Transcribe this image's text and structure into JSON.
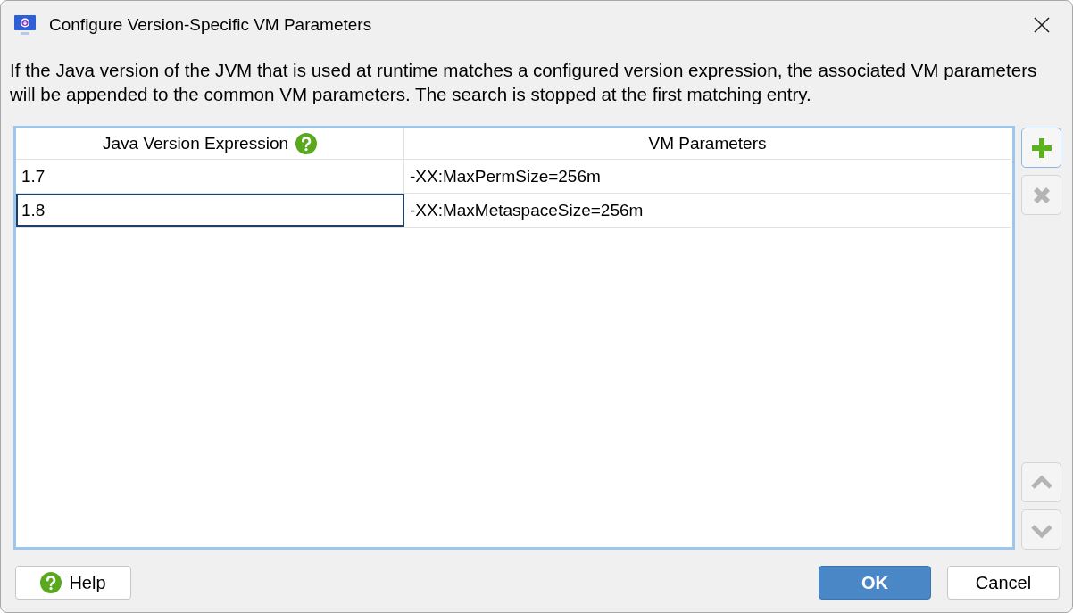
{
  "window": {
    "title": "Configure Version-Specific VM Parameters"
  },
  "description": "If the Java version of the JVM that is used at runtime matches a configured version expression, the associated VM parameters will be appended to the common VM parameters. The search is stopped at the first matching entry.",
  "table": {
    "columns": [
      {
        "label": "Java Version Expression",
        "help": true
      },
      {
        "label": "VM Parameters",
        "help": false
      }
    ],
    "rows": [
      {
        "cells": [
          "1.7",
          "-XX:MaxPermSize=256m"
        ],
        "selected": false
      },
      {
        "cells": [
          "1.8",
          "-XX:MaxMetaspaceSize=256m"
        ],
        "selected": true
      }
    ]
  },
  "side_buttons": [
    {
      "kind": "add",
      "disabled": false
    },
    {
      "kind": "remove",
      "disabled": true
    },
    {
      "kind": "up",
      "disabled": true
    },
    {
      "kind": "down",
      "disabled": true
    }
  ],
  "buttons": {
    "help": "Help",
    "ok": "OK",
    "cancel": "Cancel"
  }
}
